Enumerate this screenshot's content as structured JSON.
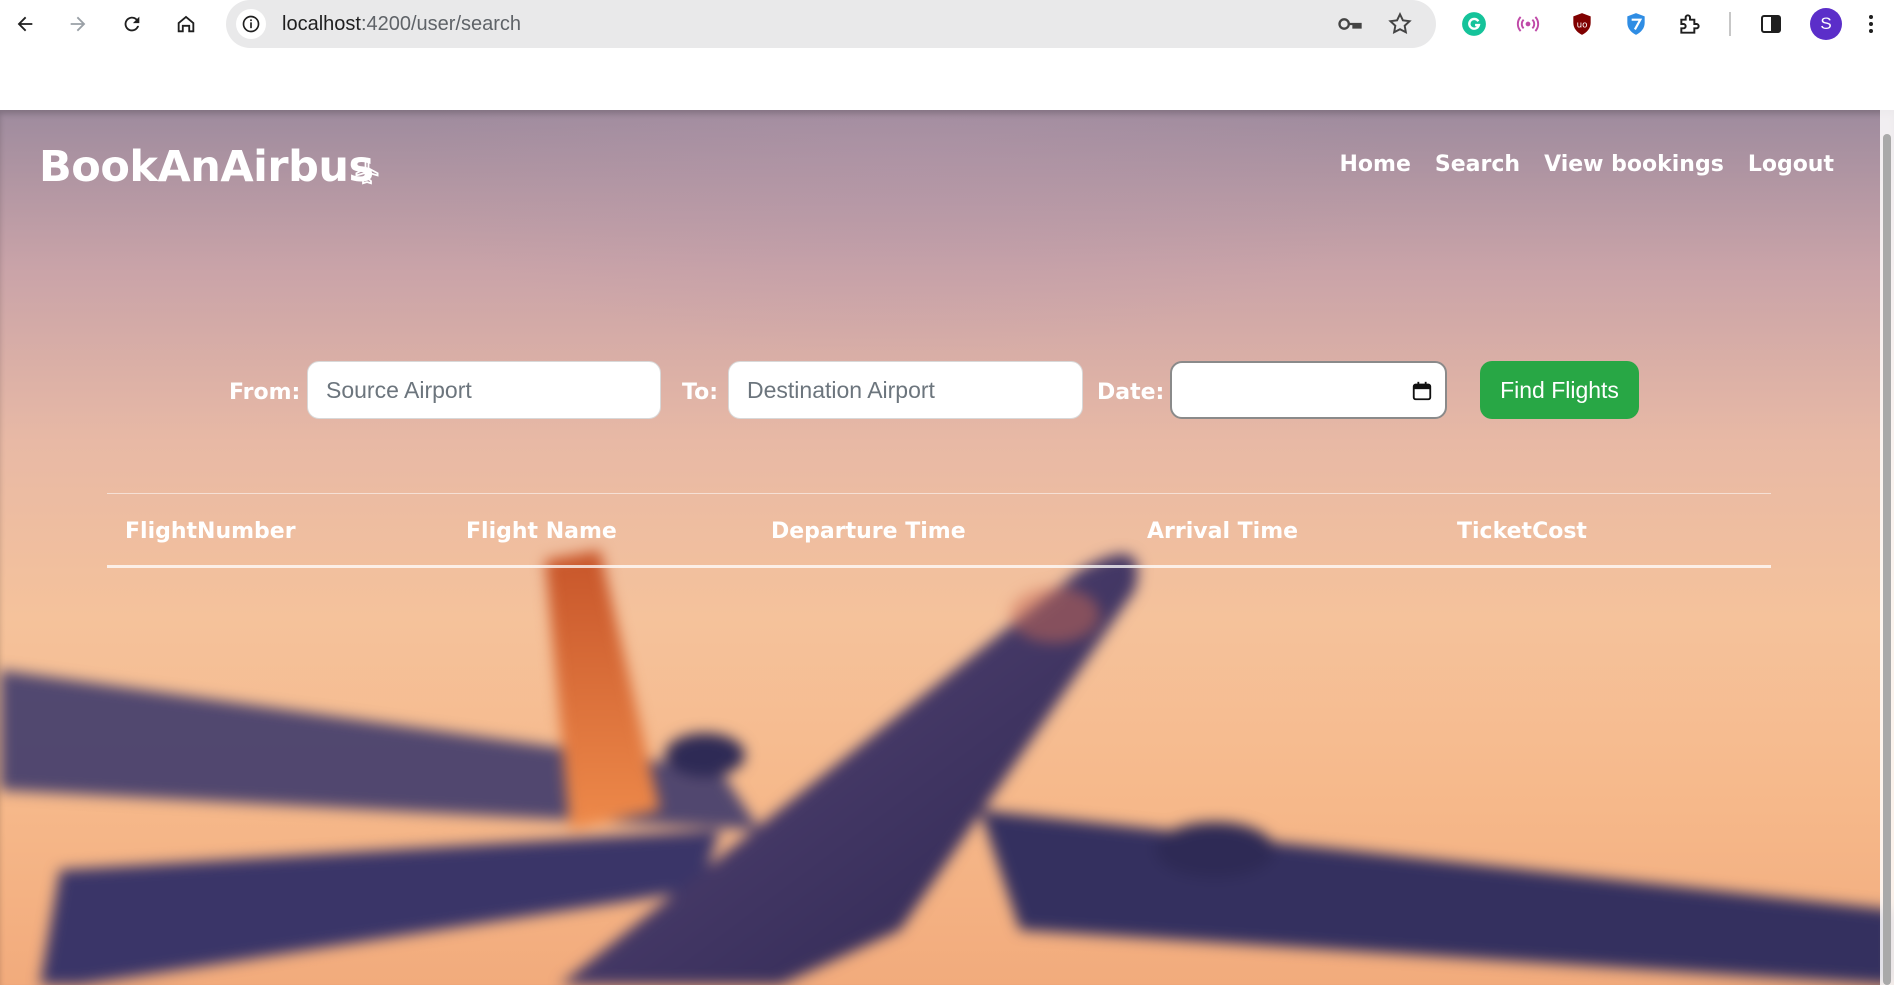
{
  "browser": {
    "url_host": "localhost",
    "url_path": ":4200/user/search",
    "profile_initial": "S",
    "extensions": [
      "grammarly-icon",
      "podcast-icon",
      "ublock-icon",
      "shield-vpn-icon",
      "puzzle-extensions-icon"
    ]
  },
  "header": {
    "brand": "BookAnAirbus",
    "brand_icon": "airplane-icon",
    "nav": {
      "home": "Home",
      "search": "Search",
      "view_bookings": "View bookings",
      "logout": "Logout"
    }
  },
  "search": {
    "from_label": "From:",
    "from_placeholder": "Source Airport",
    "to_label": "To:",
    "to_placeholder": "Destination Airport",
    "date_label": "Date:",
    "date_value": "",
    "find_button": "Find Flights"
  },
  "table": {
    "columns": [
      "FlightNumber",
      "Flight Name",
      "Departure Time",
      "Arrival Time",
      "TicketCost"
    ],
    "rows": []
  },
  "colors": {
    "accent_green": "#28a745",
    "avatar": "#5b2ec9"
  }
}
